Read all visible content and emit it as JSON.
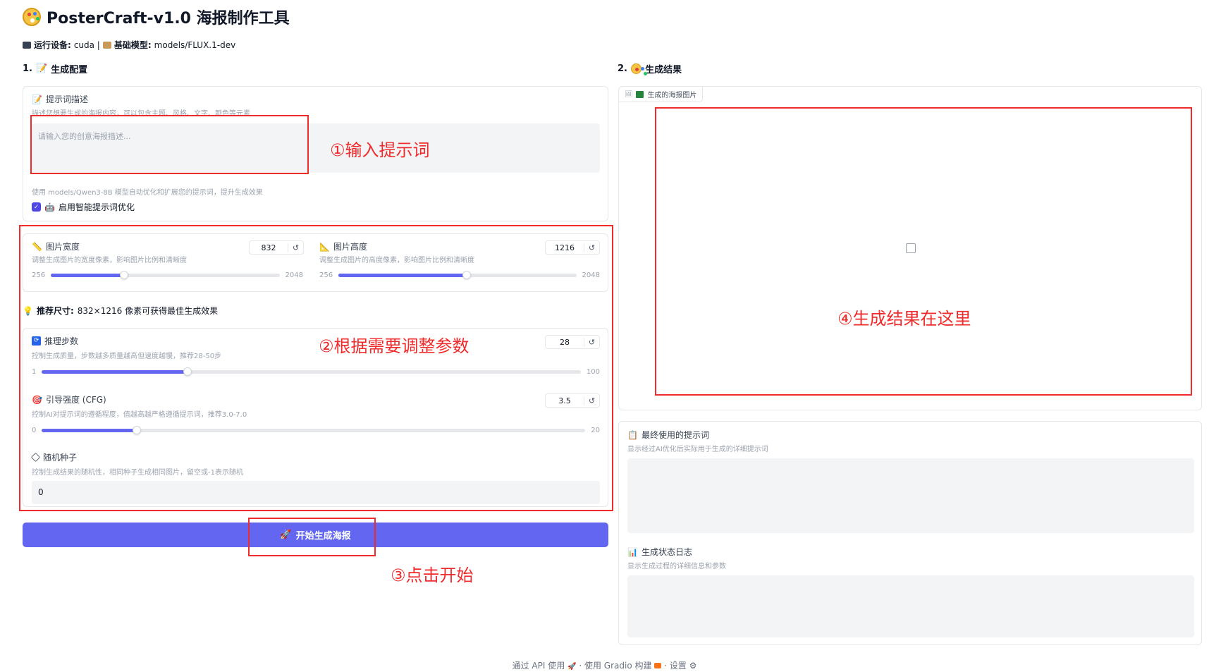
{
  "app": {
    "title": "PosterCraft-v1.0 海报制作工具",
    "device_label": "运行设备:",
    "device_value": "cuda |",
    "model_label": "基础模型:",
    "model_value": "models/FLUX.1-dev"
  },
  "config": {
    "section_number": "1.",
    "section_title": "生成配置",
    "prompt_label": "提示词描述",
    "prompt_info": "描述您想要生成的海报内容，可以包含主题、风格、文字、颜色等元素",
    "prompt_placeholder": "请输入您的创意海报描述...",
    "enhance_info": "使用 models/Qwen3-8B 模型自动优化和扩展您的提示词，提升生成效果",
    "enhance_label": "启用智能提示词优化",
    "enhance_checked": true,
    "width": {
      "label": "图片宽度",
      "info": "调整生成图片的宽度像素，影响图片比例和清晰度",
      "value": "832",
      "min": "256",
      "max": "2048",
      "fraction": 0.32
    },
    "height": {
      "label": "图片高度",
      "info": "调整生成图片的高度像素，影响图片比例和清晰度",
      "value": "1216",
      "min": "256",
      "max": "2048",
      "fraction": 0.54
    },
    "recommend_label": "推荐尺寸:",
    "recommend_text": "832×1216 像素可获得最佳生成效果",
    "steps": {
      "label": "推理步数",
      "info": "控制生成质量，步数越多质量越高但速度越慢，推荐28-50步",
      "value": "28",
      "min": "1",
      "max": "100",
      "fraction": 0.27
    },
    "cfg": {
      "label": "引导强度 (CFG)",
      "info": "控制AI对提示词的遵循程度，值越高越严格遵循提示词，推荐3.0-7.0",
      "value": "3.5",
      "min": "0",
      "max": "20",
      "fraction": 0.175
    },
    "seed": {
      "label": "随机种子",
      "info": "控制生成结果的随机性，相同种子生成相同图片，留空或-1表示随机",
      "value": "0"
    },
    "reset_symbol": "↺",
    "generate_button": "开始生成海报"
  },
  "results": {
    "section_number": "2.",
    "section_title": "生成结果",
    "image_tab": "生成的海报图片",
    "final_prompt_label": "最终使用的提示词",
    "final_prompt_info": "显示经过AI优化后实际用于生成的详细提示词",
    "status_label": "生成状态日志",
    "status_info": "显示生成过程的详细信息和参数"
  },
  "annotations": {
    "step1": "①输入提示词",
    "step2": "②根据需要调整参数",
    "step3": "③点击开始",
    "step4": "④生成结果在这里"
  },
  "footer": {
    "api": "通过 API 使用",
    "gradio": "使用 Gradio 构建",
    "settings": "设置",
    "separator": "·"
  },
  "colors": {
    "accent": "#6366f1",
    "annotation_red": "#ef2b2b"
  }
}
